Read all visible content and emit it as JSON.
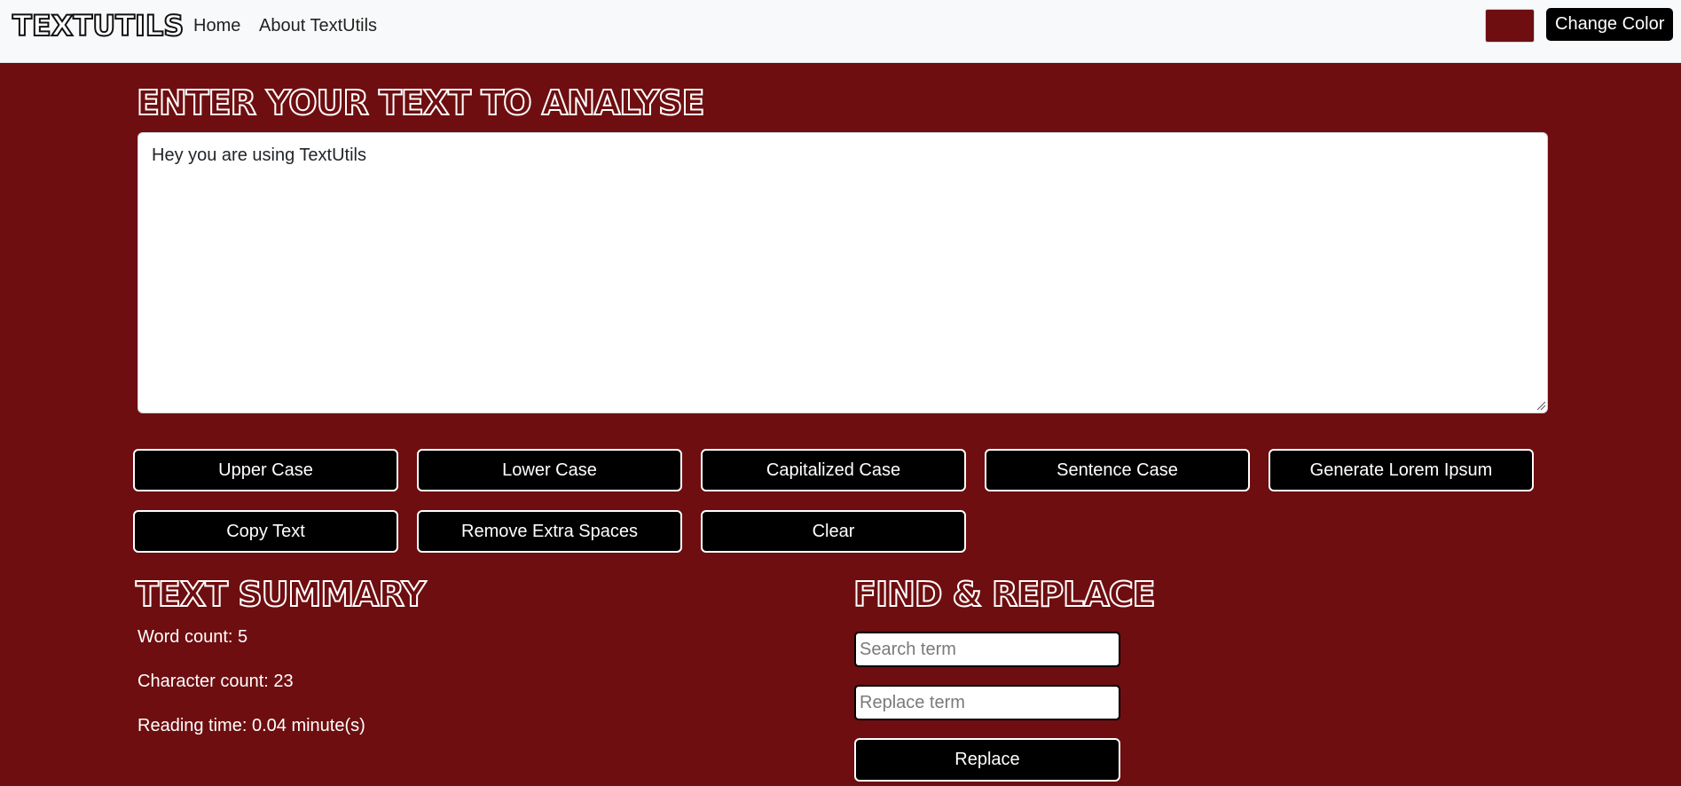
{
  "navbar": {
    "brand": "TEXTUTILS",
    "links": [
      {
        "label": "Home"
      },
      {
        "label": "About TextUtils"
      }
    ],
    "color_picker_value": "#6e0e10",
    "change_color_label": "Change Color"
  },
  "main": {
    "heading": "ENTER YOUR TEXT TO ANALYSE",
    "textarea_value": "Hey you are using TextUtils",
    "buttons": [
      {
        "label": "Upper Case"
      },
      {
        "label": "Lower Case"
      },
      {
        "label": "Capitalized Case"
      },
      {
        "label": "Sentence Case"
      },
      {
        "label": "Generate Lorem Ipsum"
      },
      {
        "label": "Copy Text"
      },
      {
        "label": "Remove Extra Spaces"
      },
      {
        "label": "Clear"
      }
    ]
  },
  "summary": {
    "heading": "TEXT SUMMARY",
    "word_count": "Word count: 5",
    "character_count": "Character count: 23",
    "reading_time": "Reading time: 0.04 minute(s)"
  },
  "find_replace": {
    "heading": "FIND & REPLACE",
    "search_placeholder": "Search term",
    "replace_placeholder": "Replace term",
    "replace_button": "Replace"
  },
  "colors": {
    "background": "#6e0e10",
    "navbar": "#f8f9fa",
    "button": "#000000"
  }
}
